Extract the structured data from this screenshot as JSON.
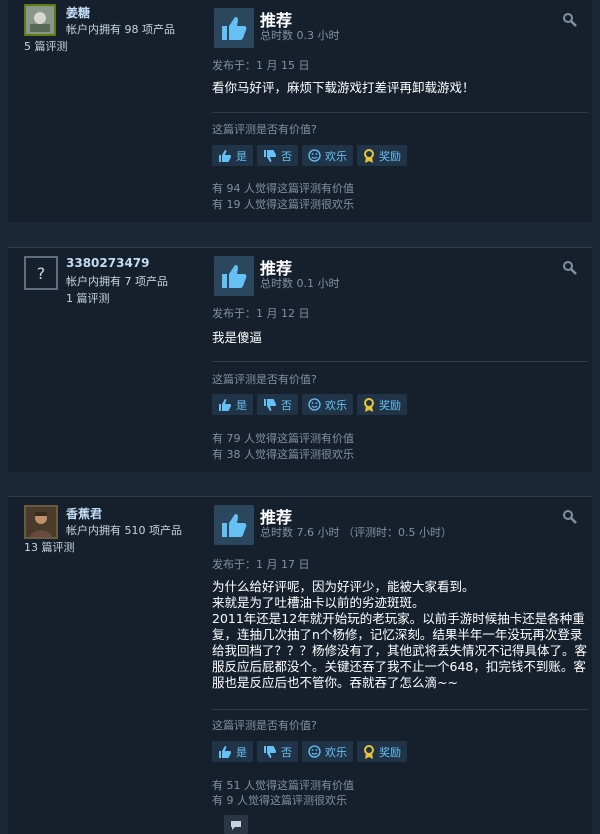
{
  "reviews": [
    {
      "author_name": "姜糖",
      "owned": "帐户内拥有 98 项产品",
      "review_count": "5 篇评测",
      "recommendation": "推荐",
      "hours": "总时数 0.3 小时",
      "posted": "发布于：1 月 15 日",
      "body": "看你马好评，麻烦下载游戏打差评再卸载游戏！",
      "helpful_question": "这篇评测是否有价值?",
      "btn_yes": "是",
      "btn_no": "否",
      "btn_funny": "欢乐",
      "btn_award": "奖励",
      "helpful_count": "有 94 人觉得这篇评测有价值",
      "funny_count": "有 19 人觉得这篇评测很欢乐"
    },
    {
      "author_name": "3380273479",
      "owned": "帐户内拥有 7 项产品",
      "review_count": "1 篇评测",
      "recommendation": "推荐",
      "hours": "总时数 0.1 小时",
      "posted": "发布于：1 月 12 日",
      "body": "我是傻逼",
      "helpful_question": "这篇评测是否有价值?",
      "btn_yes": "是",
      "btn_no": "否",
      "btn_funny": "欢乐",
      "btn_award": "奖励",
      "helpful_count": "有 79 人觉得这篇评测有价值",
      "funny_count": "有 38 人觉得这篇评测很欢乐"
    },
    {
      "author_name": "香蕉君",
      "owned": "帐户内拥有 510 项产品",
      "review_count": "13 篇评测",
      "recommendation": "推荐",
      "hours": "总时数 7.6 小时 （评测时：0.5 小时）",
      "posted": "发布于：1 月 17 日",
      "body_lines": [
        "为什么给好评呢，因为好评少，能被大家看到。",
        "来就是为了吐槽油卡以前的劣迹斑斑。",
        "2011年还是12年就开始玩的老玩家。以前手游时候抽卡还是各种重复，连抽几次抽了n个杨修，记忆深刻。结果半年一年没玩再次登录给我回档了？？？杨修没有了，其他武将丢失情况不记得具体了。客服反应后屁都没个。关键还吞了我不止一个648，扣完钱不到账。客服也是反应后也不管你。吞就吞了怎么滴~~"
      ],
      "helpful_question": "这篇评测是否有价值?",
      "btn_yes": "是",
      "btn_no": "否",
      "btn_funny": "欢乐",
      "btn_award": "奖励",
      "helpful_count": "有 51 人觉得这篇评测有价值",
      "funny_count": "有 9 人觉得这篇评测很欢乐"
    }
  ],
  "colors": {
    "page_bg": "#1b2838",
    "card_bg": "#16202d",
    "link": "#66c0f4",
    "muted": "#8091a2"
  },
  "icons": [
    "thumbs-up-icon",
    "thumbs-down-icon",
    "smiley-icon",
    "award-icon",
    "gear-icon",
    "comment-icon"
  ]
}
